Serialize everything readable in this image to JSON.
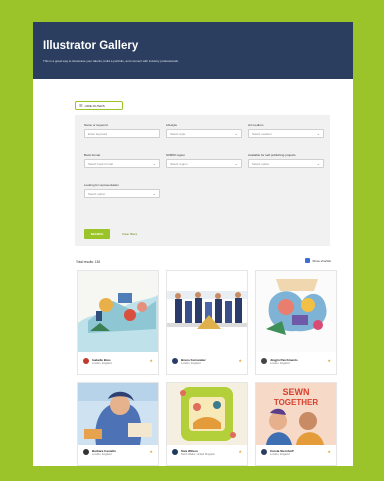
{
  "header": {
    "title": "Illustrator Gallery",
    "subtitle": "This is a great way to showcase your talents, build a portfolio, and connect with industry professionals."
  },
  "filters": {
    "toggle_label": "HIDE FILTERS",
    "fields": [
      {
        "label": "Name or keyword",
        "placeholder": "Enter keyword",
        "has_chevron": false
      },
      {
        "label": "Lifestyle",
        "placeholder": "Select style",
        "has_chevron": true
      },
      {
        "label": "Art medium",
        "placeholder": "Select medium",
        "has_chevron": true
      },
      {
        "label": "Book format",
        "placeholder": "Select book format",
        "has_chevron": true
      },
      {
        "label": "SCBWI region",
        "placeholder": "Select region",
        "has_chevron": true
      },
      {
        "label": "Available for self publishing projects",
        "placeholder": "Select option",
        "has_chevron": true
      },
      {
        "label": "Looking for representation",
        "placeholder": "Select option",
        "has_chevron": true
      }
    ],
    "search_label": "SEARCH",
    "clear_label": "Clear filters"
  },
  "results": {
    "count_text": "Total results: 136",
    "shortlist_label": "Show shortlist"
  },
  "cards": [
    {
      "name": "Isabelle Brus",
      "location": "London, England",
      "avatar_color": "#c0392b"
    },
    {
      "name": "Bruno Fernandez",
      "location": "London, England",
      "avatar_color": "#2a3b6a"
    },
    {
      "name": "Jingjin Parchments",
      "location": "London, England",
      "avatar_color": "#444444"
    },
    {
      "name": "Barbara Castelló",
      "location": "London, England",
      "avatar_color": "#333333"
    },
    {
      "name": "Siva Wilson",
      "location": "North Wales, United Kingdom",
      "avatar_color": "#1f3a5f"
    },
    {
      "name": "Carola Sternhoff",
      "location": "London, England",
      "avatar_color": "#2b3e5f"
    }
  ],
  "art": {
    "card6_banner": [
      "SEWN",
      "TOGETHER"
    ]
  },
  "colors": {
    "frame": "#9bc42a",
    "header": "#2b3e5f",
    "accent": "#9bc42a",
    "star": "#e3a23a",
    "shortlist_icon": "#3b6fd8"
  }
}
